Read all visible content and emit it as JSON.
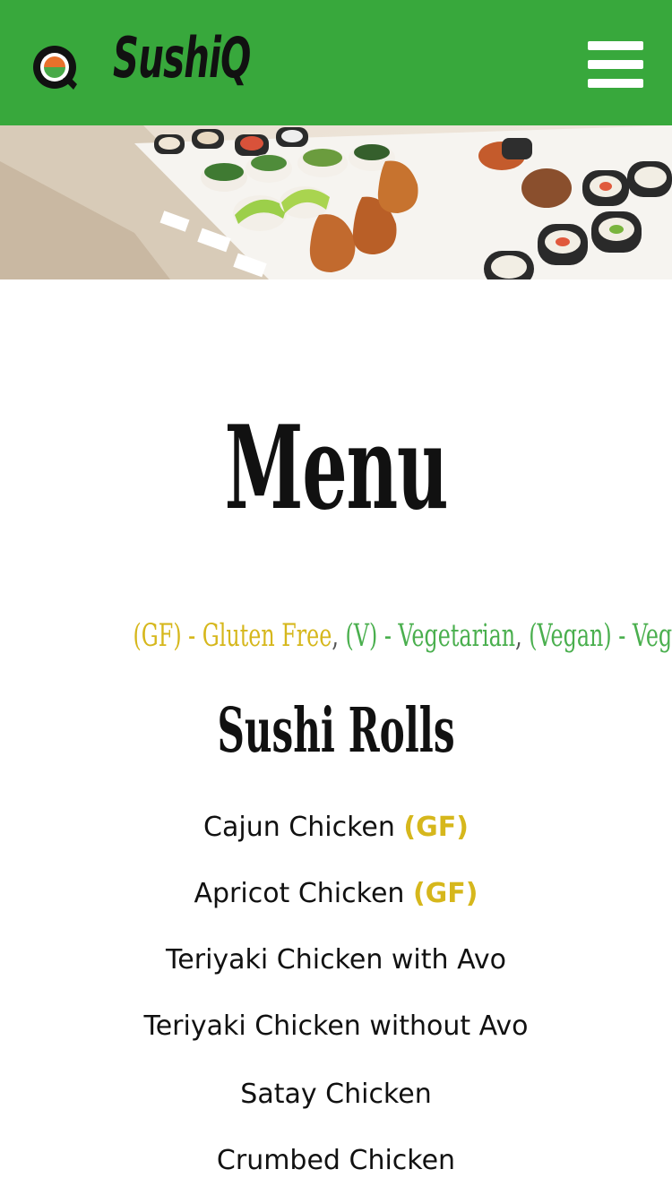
{
  "header": {
    "brand": "SushiQ",
    "menu_icon": "hamburger-menu-icon",
    "logo_icon": "sushi-q-logo-icon",
    "bg_color": "#38a83c"
  },
  "hero": {
    "image": "sushi-display-photo"
  },
  "page": {
    "title": "Menu"
  },
  "legend": {
    "gf": "(GF) - Gluten Free",
    "comma1": ",",
    "v": "(V) - Vegetarian",
    "comma2": ",",
    "vegan": "(Vegan) - Vegan",
    "gf_color": "#d6b71c",
    "veg_color": "#4aaf4e"
  },
  "section": {
    "title": "Sushi Rolls"
  },
  "items": [
    {
      "name": "Cajun Chicken",
      "tag": "(GF)"
    },
    {
      "name": "Apricot Chicken",
      "tag": "(GF)"
    },
    {
      "name": "Teriyaki Chicken with Avo",
      "tag": ""
    },
    {
      "name": "Teriyaki Chicken without Avo",
      "tag": ""
    },
    {
      "name": "Satay Chicken",
      "tag": ""
    },
    {
      "name": "Crumbed Chicken",
      "tag": ""
    }
  ]
}
